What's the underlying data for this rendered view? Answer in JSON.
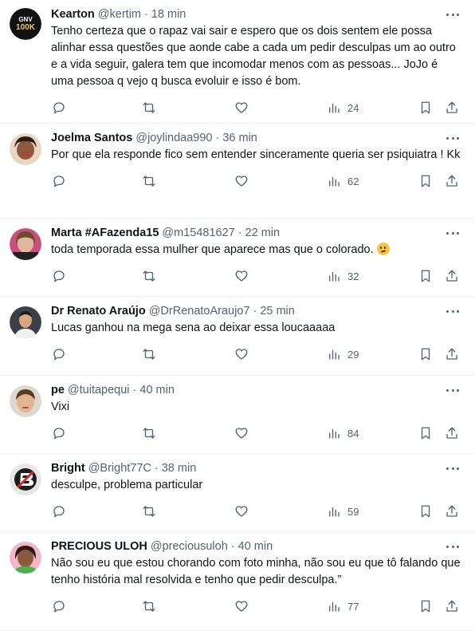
{
  "icons": {
    "reply": "reply-icon",
    "retweet": "retweet-icon",
    "like": "like-icon",
    "views": "views-icon",
    "bookmark": "bookmark-icon",
    "share": "share-icon",
    "more": "more-icon"
  },
  "colors": {
    "text": "#0f1419",
    "secondary": "#536471",
    "divider": "#eff3f4"
  },
  "separator": "·",
  "tweets": [
    {
      "name": "Kearton",
      "handle": "@kertim",
      "time": "18 min",
      "text": "Tenho certeza que o rapaz vai sair e espero que os dois sentem ele possa alinhar essa questões que aonde cabe a cada um pedir desculpas um ao outro e a vida seguir, galera tem que incomodar menos com as pessoas... JoJo é uma pessoa q vejo q busca evoluir e isso é bom.",
      "views": "24",
      "avatar_text": [
        "GNV",
        "100K"
      ]
    },
    {
      "name": "Joelma Santos",
      "handle": "@joylindaa990",
      "time": "36 min",
      "text": "Por que ela responde  fico sem entender  sinceramente  queria ser psiquiatra  ! Kk",
      "views": "62"
    },
    {
      "name": "Marta #AFazenda15",
      "handle": "@m15481627",
      "time": "22 min",
      "text": "toda temporada essa mulher que aparece mas que o colorado.",
      "views": "32",
      "emoji": "thinking-face-emoji"
    },
    {
      "name": "Dr Renato Araújo",
      "handle": "@DrRenatoAraujo7",
      "time": "25 min",
      "text": "Lucas ganhou na mega sena ao deixar essa loucaaaaa",
      "views": "29"
    },
    {
      "name": "pe",
      "handle": "@tuitapequi",
      "time": "40 min",
      "text": "Vixi",
      "views": "84"
    },
    {
      "name": "Bright",
      "handle": "@Bright77C",
      "time": "38 min",
      "text": "desculpe, problema particular",
      "views": "59"
    },
    {
      "name": "PRECIOUS ULOH",
      "handle": "@preciousuloh",
      "time": "40 min",
      "text": "Não sou eu que estou chorando com foto minha, não sou eu que tô falando que tenho história mal resolvida e tenho que pedir desculpa.”",
      "views": "77"
    }
  ]
}
